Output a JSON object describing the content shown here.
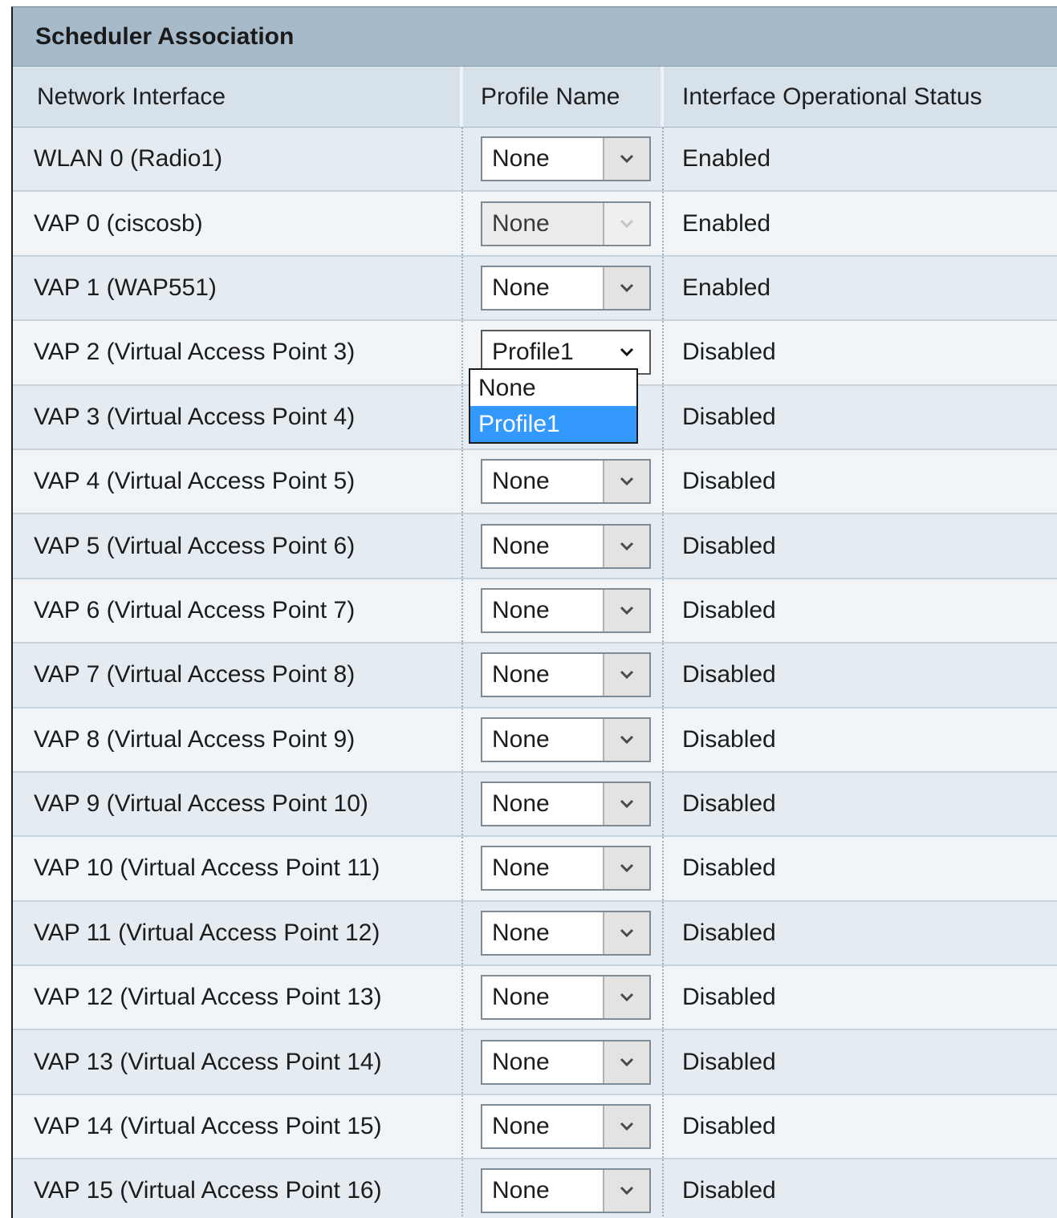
{
  "title": "Scheduler Association",
  "columns": {
    "interface": "Network Interface",
    "profile": "Profile Name",
    "status": "Interface Operational Status"
  },
  "rows": [
    {
      "interface": "WLAN 0 (Radio1)",
      "profile": "None",
      "status": "Enabled",
      "state": "normal"
    },
    {
      "interface": "VAP 0 (ciscosb)",
      "profile": "None",
      "status": "Enabled",
      "state": "disabled"
    },
    {
      "interface": "VAP 1 (WAP551)",
      "profile": "None",
      "status": "Enabled",
      "state": "normal"
    },
    {
      "interface": "VAP 2 (Virtual Access Point 3)",
      "profile": "Profile1",
      "status": "Disabled",
      "state": "open"
    },
    {
      "interface": "VAP 3 (Virtual Access Point 4)",
      "profile": "",
      "status": "Disabled",
      "state": "hidden"
    },
    {
      "interface": "VAP 4 (Virtual Access Point 5)",
      "profile": "None",
      "status": "Disabled",
      "state": "normal"
    },
    {
      "interface": "VAP 5 (Virtual Access Point 6)",
      "profile": "None",
      "status": "Disabled",
      "state": "normal"
    },
    {
      "interface": "VAP 6 (Virtual Access Point 7)",
      "profile": "None",
      "status": "Disabled",
      "state": "normal"
    },
    {
      "interface": "VAP 7 (Virtual Access Point 8)",
      "profile": "None",
      "status": "Disabled",
      "state": "normal"
    },
    {
      "interface": "VAP 8 (Virtual Access Point 9)",
      "profile": "None",
      "status": "Disabled",
      "state": "normal"
    },
    {
      "interface": "VAP 9 (Virtual Access Point 10)",
      "profile": "None",
      "status": "Disabled",
      "state": "normal"
    },
    {
      "interface": "VAP 10 (Virtual Access Point 11)",
      "profile": "None",
      "status": "Disabled",
      "state": "normal"
    },
    {
      "interface": "VAP 11 (Virtual Access Point 12)",
      "profile": "None",
      "status": "Disabled",
      "state": "normal"
    },
    {
      "interface": "VAP 12 (Virtual Access Point 13)",
      "profile": "None",
      "status": "Disabled",
      "state": "normal"
    },
    {
      "interface": "VAP 13 (Virtual Access Point 14)",
      "profile": "None",
      "status": "Disabled",
      "state": "normal"
    },
    {
      "interface": "VAP 14 (Virtual Access Point 15)",
      "profile": "None",
      "status": "Disabled",
      "state": "normal"
    },
    {
      "interface": "VAP 15 (Virtual Access Point 16)",
      "profile": "None",
      "status": "Disabled",
      "state": "normal"
    }
  ],
  "dropdown": {
    "options": [
      "None",
      "Profile1"
    ],
    "selected": "Profile1"
  },
  "icons": {
    "select_arrow": "chevron-down-icon"
  },
  "colors": {
    "title_bar": "#a7bac9",
    "header_row": "#d6e1ea",
    "row_odd": "#e4ebf1",
    "row_even": "#f1f5f8",
    "selected_option": "#3399ff"
  }
}
